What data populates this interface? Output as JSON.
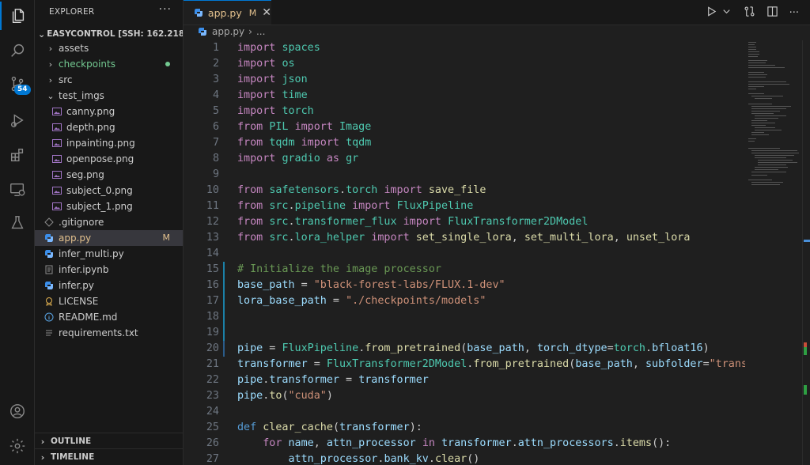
{
  "sidebar": {
    "title": "EXPLORER",
    "root": "EASYCONTROL [SSH: 162.218....",
    "items": [
      {
        "name": "assets",
        "type": "folder",
        "expanded": false
      },
      {
        "name": "checkpoints",
        "type": "folder",
        "expanded": false,
        "git": "dot"
      },
      {
        "name": "src",
        "type": "folder",
        "expanded": false
      },
      {
        "name": "test_imgs",
        "type": "folder",
        "expanded": true
      },
      {
        "name": "canny.png",
        "type": "image"
      },
      {
        "name": "depth.png",
        "type": "image"
      },
      {
        "name": "inpainting.png",
        "type": "image"
      },
      {
        "name": "openpose.png",
        "type": "image"
      },
      {
        "name": "seg.png",
        "type": "image"
      },
      {
        "name": "subject_0.png",
        "type": "image"
      },
      {
        "name": "subject_1.png",
        "type": "image"
      },
      {
        "name": ".gitignore",
        "type": "git"
      },
      {
        "name": "app.py",
        "type": "python",
        "git": "M",
        "selected": true
      },
      {
        "name": "infer_multi.py",
        "type": "python"
      },
      {
        "name": "infer.ipynb",
        "type": "notebook"
      },
      {
        "name": "infer.py",
        "type": "python"
      },
      {
        "name": "LICENSE",
        "type": "license"
      },
      {
        "name": "README.md",
        "type": "markdown"
      },
      {
        "name": "requirements.txt",
        "type": "text"
      }
    ],
    "outline": "OUTLINE",
    "timeline": "TIMELINE"
  },
  "activity": {
    "scm_badge": "54"
  },
  "tab": {
    "name": "app.py",
    "status": "M"
  },
  "breadcrumb": {
    "file": "app.py",
    "sep": "›",
    "more": "..."
  },
  "colors": {
    "accent": "#0078d4",
    "modified": "#e2c08d",
    "added": "#73c991"
  }
}
